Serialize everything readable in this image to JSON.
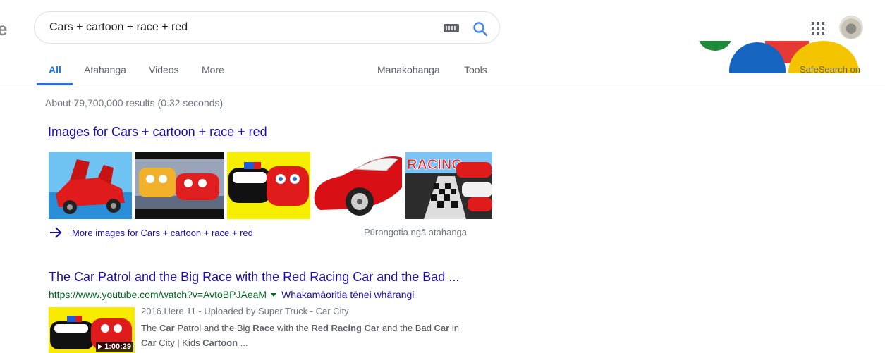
{
  "header": {
    "logo_fragment": "e",
    "search_query": "Cars + cartoon + race + red",
    "safesearch": "SafeSearch on",
    "icons": [
      "keyboard-icon",
      "search-icon",
      "apps-icon",
      "avatar"
    ]
  },
  "tabs": [
    {
      "label": "All",
      "active": true
    },
    {
      "label": "Atahanga"
    },
    {
      "label": "Videos"
    },
    {
      "label": "More"
    },
    {
      "label": "Manakohanga"
    },
    {
      "label": "Tools"
    }
  ],
  "stats": "About 79,700,000 results (0.32 seconds)",
  "images_block": {
    "title": "Images for Cars + cartoon + race + red",
    "more_link": "More images for Cars + cartoon + race + red",
    "feedback": "Pūrongotia ngā atahanga",
    "thumb_overlay_text": "RACING"
  },
  "result": {
    "title": "The Car Patrol and the Big Race with the Red Racing Car and the Bad ...",
    "url": "https://www.youtube.com/watch?v=AvtoBPJAeaM",
    "translate": "Whakamāoritia tēnei whārangi",
    "meta": "2016 Here 11 - Uploaded by Super Truck - Car City",
    "duration": "1:00:29",
    "snippet_parts": [
      "The ",
      "Car",
      " Patrol and the Big ",
      "Race",
      " with the ",
      "Red Racing Car",
      " and the Bad ",
      "Car",
      " in",
      "Car",
      " City | Kids ",
      "Cartoon",
      " ..."
    ]
  },
  "colors": {
    "link": "#1a0dab",
    "url_green": "#006621",
    "active_tab": "#1a73e8"
  }
}
